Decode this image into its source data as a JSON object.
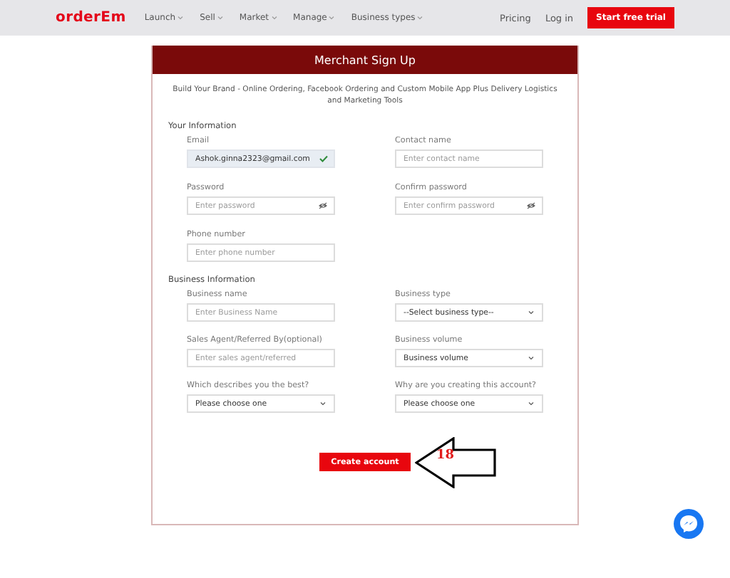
{
  "navbar": {
    "logo": "orderEm",
    "menu": [
      {
        "label": "Launch",
        "has_dropdown": true
      },
      {
        "label": "Sell",
        "has_dropdown": true
      },
      {
        "label": "Market",
        "has_dropdown": true
      },
      {
        "label": "Manage",
        "has_dropdown": true
      },
      {
        "label": "Business types",
        "has_dropdown": true
      }
    ],
    "links": [
      "Pricing",
      "Log in"
    ],
    "cta": "Start free trial"
  },
  "form": {
    "title": "Merchant Sign Up",
    "subtitle": "Build Your Brand - Online Ordering, Facebook Ordering and Custom Mobile App Plus Delivery Logistics and Marketing Tools",
    "sections": [
      {
        "title": "Your Information",
        "fields": [
          {
            "label": "Email",
            "kind": "text",
            "value": "Ashok.ginna2323@gmail.com",
            "valid": true
          },
          {
            "label": "Contact name",
            "kind": "text",
            "placeholder": "Enter contact name"
          },
          {
            "label": "Password",
            "kind": "password",
            "placeholder": "Enter password"
          },
          {
            "label": "Confirm password",
            "kind": "password",
            "placeholder": "Enter confirm password"
          },
          {
            "label": "Phone number",
            "kind": "text",
            "placeholder": "Enter phone number"
          }
        ]
      },
      {
        "title": "Business Information",
        "fields": [
          {
            "label": "Business name",
            "kind": "text",
            "placeholder": "Enter Business Name"
          },
          {
            "label": "Business type",
            "kind": "select",
            "value": "--Select business type--"
          },
          {
            "label": "Sales Agent/Referred By(optional)",
            "kind": "text",
            "placeholder": "Enter sales agent/referred"
          },
          {
            "label": "Business volume",
            "kind": "select",
            "value": "Business volume"
          },
          {
            "label": "Which describes you the best?",
            "kind": "select",
            "value": "Please choose one"
          },
          {
            "label": "Why are you creating this account?",
            "kind": "select",
            "value": "Please choose one"
          }
        ]
      }
    ],
    "submit": "Create account"
  },
  "annotation": {
    "label": "18"
  }
}
